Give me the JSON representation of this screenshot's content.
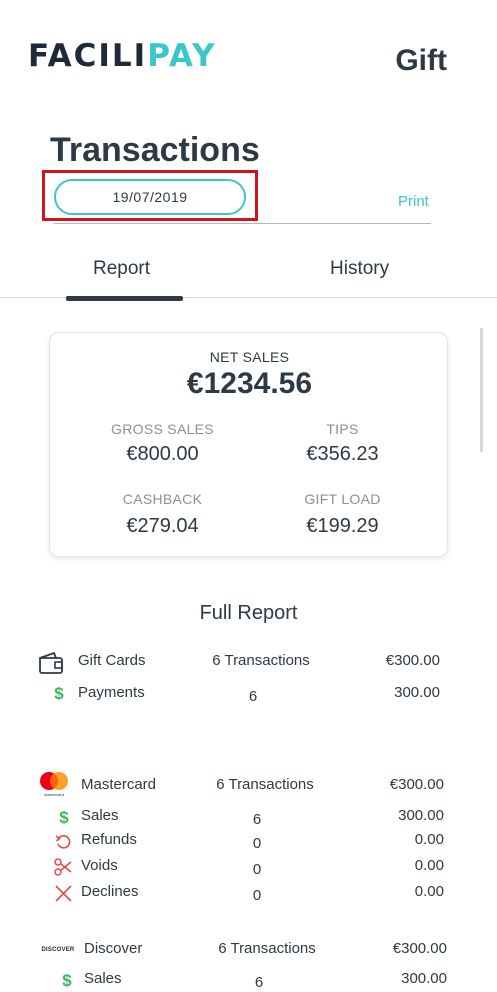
{
  "header": {
    "logo_part1": "FACILI",
    "logo_part2": "PAY",
    "title": "Gift"
  },
  "page": {
    "title": "Transactions",
    "date": "19/07/2019",
    "print_label": "Print"
  },
  "tabs": [
    {
      "label": "Report",
      "active": true
    },
    {
      "label": "History",
      "active": false
    }
  ],
  "summary": {
    "net_sales_label": "NET SALES",
    "net_sales_value": "€1234.56",
    "gross_sales_label": "GROSS SALES",
    "gross_sales_value": "€800.00",
    "tips_label": "TIPS",
    "tips_value": "€356.23",
    "cashback_label": "CASHBACK",
    "cashback_value": "€279.04",
    "gift_load_label": "GIFT LOAD",
    "gift_load_value": "€199.29"
  },
  "full_report": {
    "title": "Full Report",
    "gift_cards": {
      "name": "Gift Cards",
      "transactions": "6 Transactions",
      "amount": "€300.00",
      "rows": [
        {
          "icon": "dollar-icon",
          "label": "Payments",
          "count": "6",
          "amount": "300.00"
        }
      ]
    },
    "mastercard": {
      "name": "Mastercard",
      "logo_text": "mastercard",
      "transactions": "6 Transactions",
      "amount": "€300.00",
      "rows": [
        {
          "icon": "dollar-icon",
          "label": "Sales",
          "count": "6",
          "amount": "300.00"
        },
        {
          "icon": "refund-icon",
          "label": "Refunds",
          "count": "0",
          "amount": "0.00"
        },
        {
          "icon": "scissors-icon",
          "label": "Voids",
          "count": "0",
          "amount": "0.00"
        },
        {
          "icon": "x-icon",
          "label": "Declines",
          "count": "0",
          "amount": "0.00"
        }
      ]
    },
    "discover": {
      "name": "Discover",
      "logo_text": "DISCOVER",
      "transactions": "6 Transactions",
      "amount": "€300.00",
      "rows": [
        {
          "icon": "dollar-icon",
          "label": "Sales",
          "count": "6",
          "amount": "300.00"
        }
      ]
    }
  },
  "colors": {
    "accent": "#3bc6c9",
    "text": "#2d3a45",
    "highlight": "#d0131c",
    "dollar": "#3fb55a",
    "red_icons": "#e24a4a"
  }
}
